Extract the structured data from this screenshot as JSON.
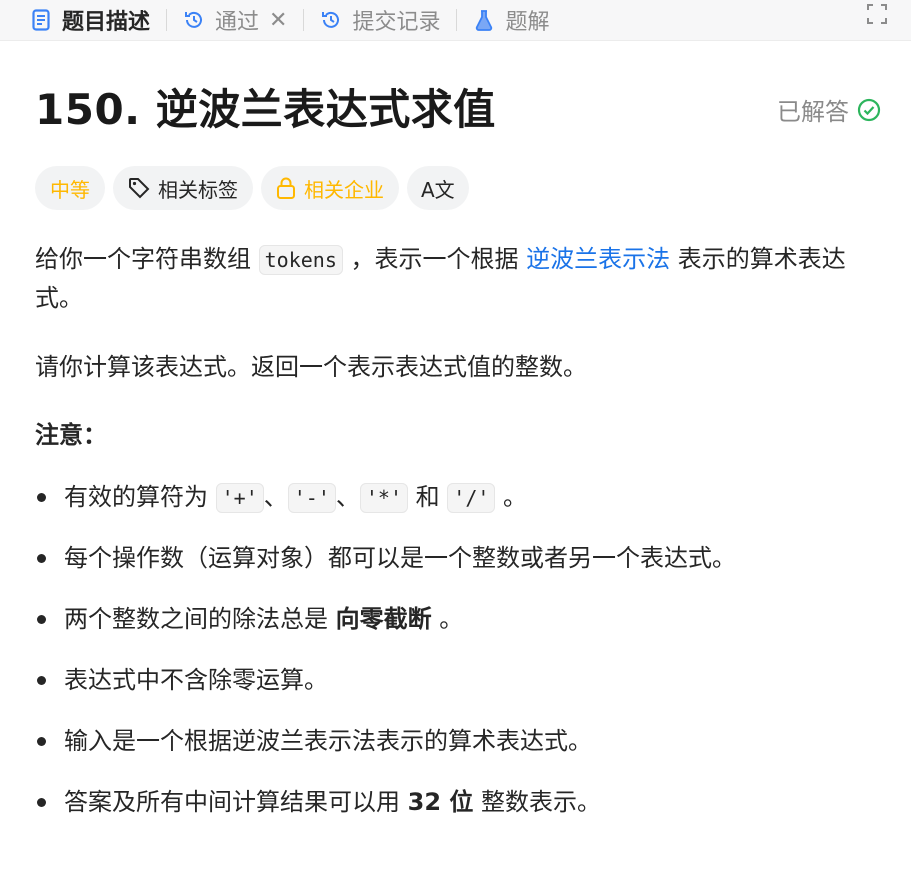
{
  "tabs": [
    {
      "label": "题目描述",
      "icon": "document-icon",
      "active": true
    },
    {
      "label": "通过",
      "icon": "history-icon",
      "closable": true
    },
    {
      "label": "提交记录",
      "icon": "history-icon"
    },
    {
      "label": "题解",
      "icon": "flask-icon"
    }
  ],
  "problem": {
    "title": "150. 逆波兰表达式求值",
    "status": "已解答",
    "tags": {
      "difficulty": "中等",
      "topics": "相关标签",
      "companies": "相关企业",
      "translate_icon_text": "A文"
    }
  },
  "description": {
    "p1_pre": "给你一个字符串数组 ",
    "p1_code": "tokens",
    "p1_mid": " ，表示一个根据 ",
    "p1_link": "逆波兰表示法",
    "p1_post": " 表示的算术表达式。",
    "p2": "请你计算该表达式。返回一个表示表达式值的整数。",
    "note_heading": "注意：",
    "notes": {
      "n1_pre": "有效的算符为 ",
      "n1_c1": "'+'",
      "n1_s1": "、",
      "n1_c2": "'-'",
      "n1_s2": "、",
      "n1_c3": "'*'",
      "n1_and": " 和 ",
      "n1_c4": "'/'",
      "n1_post": " 。",
      "n2": "每个操作数（运算对象）都可以是一个整数或者另一个表达式。",
      "n3_pre": "两个整数之间的除法总是 ",
      "n3_bold": "向零截断",
      "n3_post": " 。",
      "n4": "表达式中不含除零运算。",
      "n5": "输入是一个根据逆波兰表示法表示的算术表达式。",
      "n6_pre": "答案及所有中间计算结果可以用 ",
      "n6_bold": "32 位",
      "n6_post": " 整数表示。"
    }
  },
  "colors": {
    "accent_link": "#1a73e8",
    "difficulty_medium": "#ffb800",
    "solved_green": "#2db55d"
  }
}
